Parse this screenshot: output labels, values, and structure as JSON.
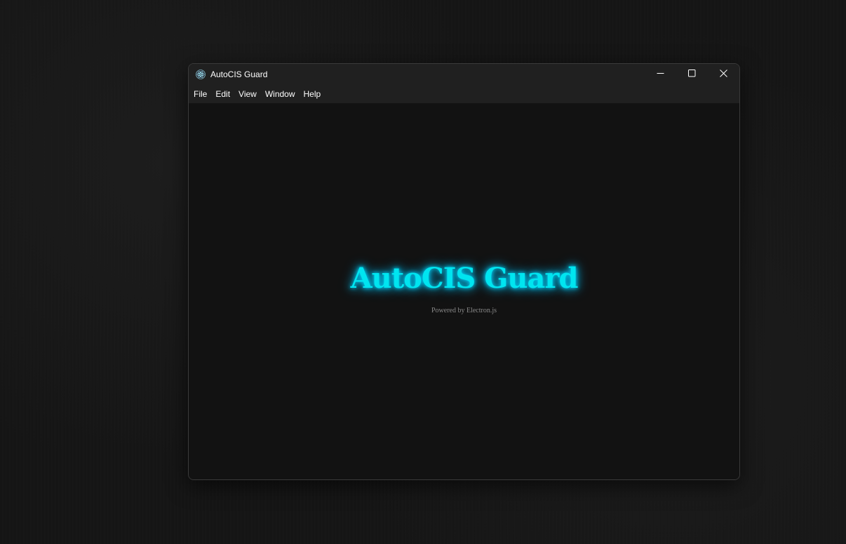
{
  "window": {
    "title": "AutoCIS Guard",
    "app_icon": "electron-icon",
    "controls": {
      "minimize_icon": "minimize-icon",
      "maximize_icon": "maximize-icon",
      "close_icon": "close-icon"
    }
  },
  "menubar": {
    "items": [
      {
        "label": "File"
      },
      {
        "label": "Edit"
      },
      {
        "label": "View"
      },
      {
        "label": "Window"
      },
      {
        "label": "Help"
      }
    ]
  },
  "main": {
    "heading": "AutoCIS Guard",
    "subtitle": "Powered by Electron.js",
    "heading_color": "#00e5f0",
    "background_color": "#121212"
  }
}
